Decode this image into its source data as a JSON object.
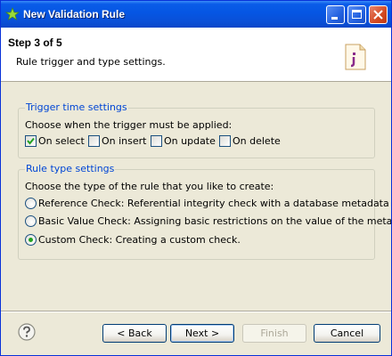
{
  "window": {
    "title": "New Validation Rule"
  },
  "header": {
    "step": "Step 3 of 5",
    "description": "Rule trigger and type settings."
  },
  "trigger": {
    "group_label": "Trigger time settings",
    "prompt": "Choose when the trigger must be applied:",
    "options": [
      {
        "label": "On select",
        "checked": true
      },
      {
        "label": "On insert",
        "checked": false
      },
      {
        "label": "On update",
        "checked": false
      },
      {
        "label": "On delete",
        "checked": false
      }
    ]
  },
  "rule_type": {
    "group_label": "Rule type settings",
    "prompt": "Choose the type of the rule that you like to create:",
    "options": [
      {
        "label": "Reference Check: Referential integrity check with a database metadata item.",
        "selected": false
      },
      {
        "label": "Basic Value Check: Assigning basic restrictions on the value of the metadata.",
        "selected": false
      },
      {
        "label": "Custom Check: Creating a custom check.",
        "selected": true
      }
    ]
  },
  "footer": {
    "help_icon": "question-circle-icon",
    "back_label": "< Back",
    "next_label": "Next >",
    "finish_label": "Finish",
    "cancel_label": "Cancel"
  },
  "colors": {
    "titlebar": "#0a5ce8",
    "group_label": "#0046d5",
    "check_mark": "#21a121"
  }
}
